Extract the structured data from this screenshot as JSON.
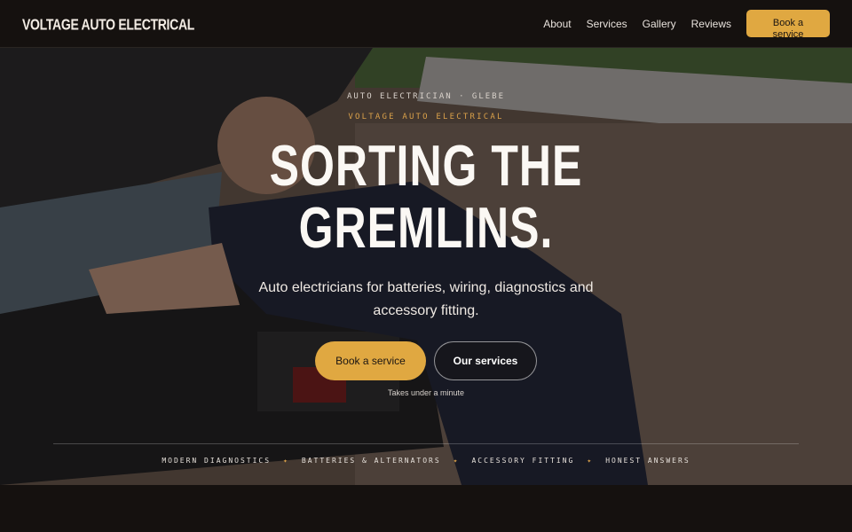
{
  "nav": {
    "logo": "VOLTAGE AUTO ELECTRICAL",
    "links": [
      "About",
      "Services",
      "Gallery",
      "Reviews"
    ],
    "cta": "Book a service"
  },
  "hero": {
    "kicker": "AUTO ELECTRICIAN · GLEBE",
    "brand": "VOLTAGE AUTO ELECTRICAL",
    "headline_1": "SORTING THE",
    "headline_2": "GREMLINS.",
    "subtitle": "Auto electricians for batteries, wiring, diagnostics and accessory fitting.",
    "primary_cta": "Book a service",
    "secondary_cta": "Our services",
    "note": "Takes under a minute",
    "features": [
      "MODERN DIAGNOSTICS",
      "BATTERIES & ALTERNATORS",
      "ACCESSORY FITTING",
      "HONEST ANSWERS"
    ]
  },
  "colors": {
    "accent": "#e0a841",
    "background": "#15110f"
  }
}
